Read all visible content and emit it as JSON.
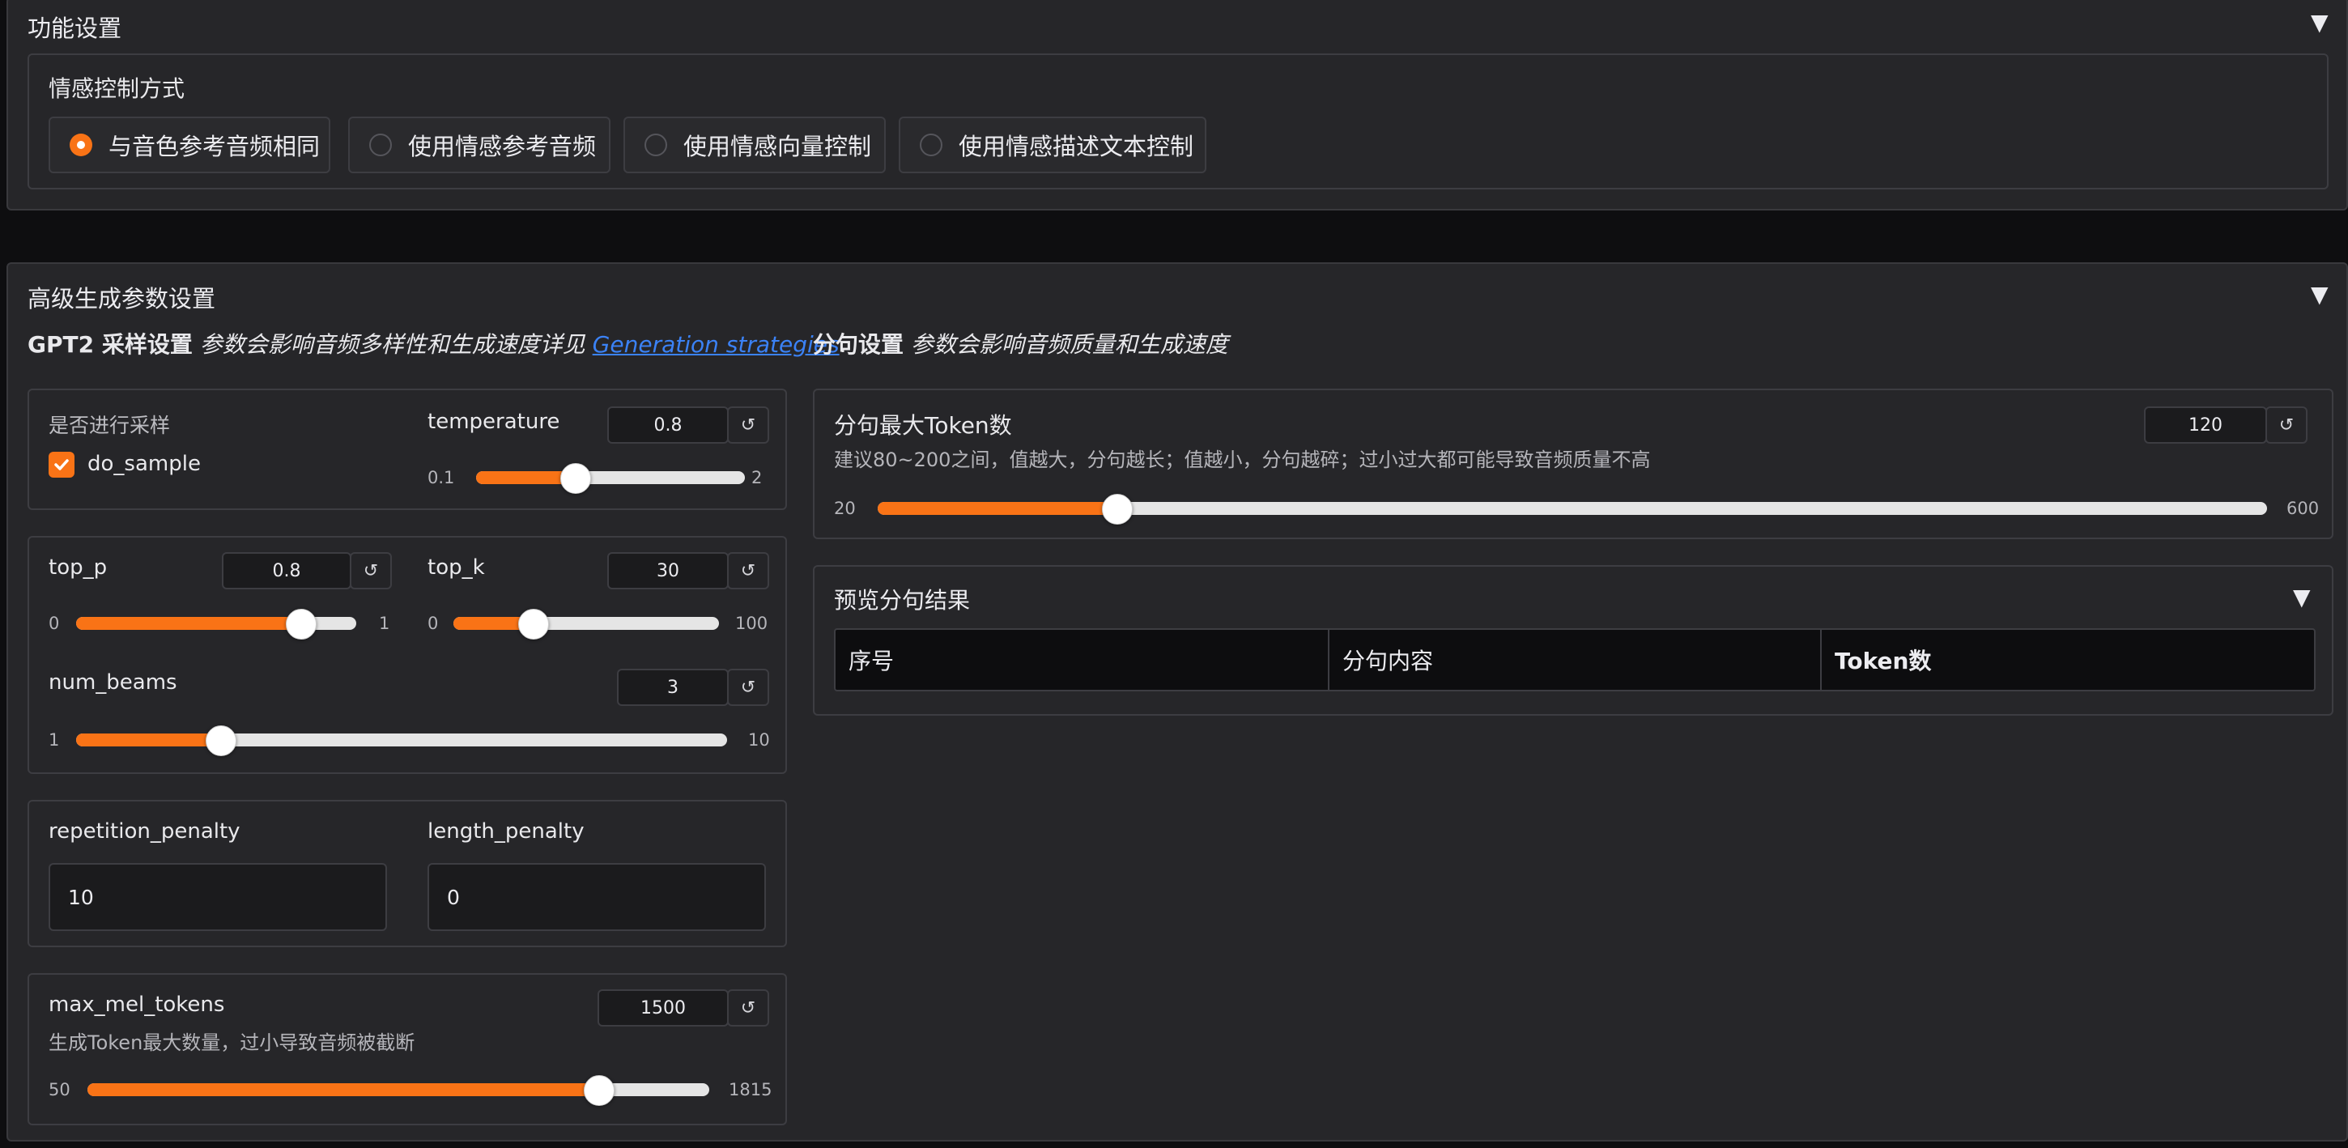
{
  "feature_section": {
    "title": "功能设置",
    "emotion_control": {
      "label": "情感控制方式",
      "options": [
        "与音色参考音频相同",
        "使用情感参考音频",
        "使用情感向量控制",
        "使用情感描述文本控制"
      ],
      "selected_index": 0
    }
  },
  "advanced_section": {
    "title": "高级生成参数设置",
    "gpt2_header": {
      "bold": "GPT2 采样设置",
      "italic": "参数会影响音频多样性和生成速度详见",
      "link": "Generation strategies",
      "tail": "."
    },
    "sentence_header": {
      "bold": "分句设置",
      "italic": "参数会影响音频质量和生成速度"
    },
    "do_sample": {
      "group_label": "是否进行采样",
      "label": "do_sample",
      "checked": true
    },
    "temperature": {
      "label": "temperature",
      "value": "0.8",
      "min": "0.1",
      "max": "2",
      "fraction": 0.368
    },
    "top_p": {
      "label": "top_p",
      "value": "0.8",
      "min": "0",
      "max": "1",
      "fraction": 0.8
    },
    "top_k": {
      "label": "top_k",
      "value": "30",
      "min": "0",
      "max": "100",
      "fraction": 0.3
    },
    "num_beams": {
      "label": "num_beams",
      "value": "3",
      "min": "1",
      "max": "10",
      "fraction": 0.222
    },
    "repetition_penalty": {
      "label": "repetition_penalty",
      "value": "10"
    },
    "length_penalty": {
      "label": "length_penalty",
      "value": "0"
    },
    "max_mel_tokens": {
      "label": "max_mel_tokens",
      "hint": "生成Token最大数量，过小导致音频被截断",
      "value": "1500",
      "min": "50",
      "max": "1815",
      "fraction": 0.821
    },
    "max_tokens_per_sentence": {
      "label": "分句最大Token数",
      "hint": "建议80~200之间，值越大，分句越长；值越小，分句越碎；过小过大都可能导致音频质量不高",
      "value": "120",
      "min": "20",
      "max": "600",
      "fraction": 0.172
    },
    "preview": {
      "title": "预览分句结果",
      "columns": [
        "序号",
        "分句内容",
        "Token数"
      ]
    },
    "reset_glyph": "↺",
    "collapse_glyph": "▼"
  },
  "colors": {
    "accent": "#f97316",
    "panel": "#262629",
    "border": "#3d3d42",
    "link": "#3b82f6"
  }
}
